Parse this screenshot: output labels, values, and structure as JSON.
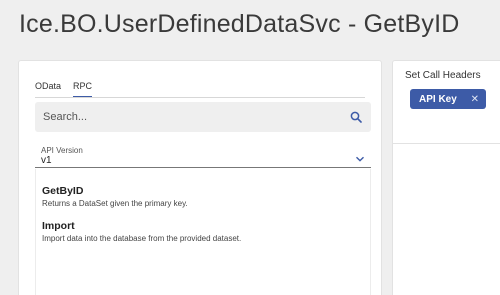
{
  "page": {
    "title": "Ice.BO.UserDefinedDataSvc - GetByID"
  },
  "tabs": [
    {
      "label": "OData",
      "active": false
    },
    {
      "label": "RPC",
      "active": true
    }
  ],
  "search": {
    "placeholder": "Search..."
  },
  "api_version": {
    "label": "API Version",
    "value": "v1"
  },
  "methods": [
    {
      "name": "GetByID",
      "description": "Returns a DataSet given the primary key."
    },
    {
      "name": "Import",
      "description": "Import data into the database from the provided dataset."
    }
  ],
  "call_headers": {
    "title": "Set Call Headers",
    "chips": [
      {
        "label": "API Key",
        "close": "✕"
      }
    ]
  },
  "colors": {
    "accent": "#3d5ba7",
    "background": "#efefef",
    "panel": "#ffffff"
  },
  "icons": {
    "search": "search-icon",
    "dropdown": "chevron-down-icon",
    "remove": "close-icon"
  }
}
